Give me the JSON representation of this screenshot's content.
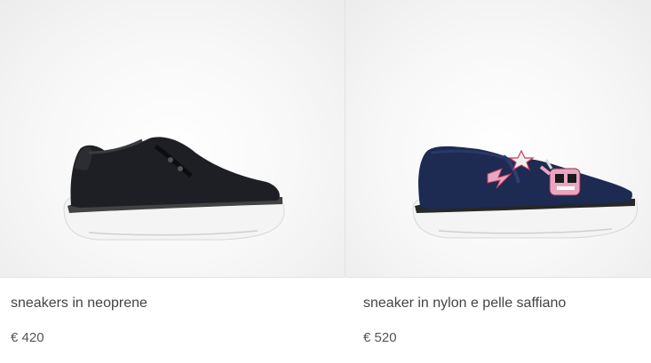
{
  "products": [
    {
      "name": "sneakers in neoprene",
      "price": "€ 420",
      "image_icon": "black-neoprene-sneaker-icon"
    },
    {
      "name": "sneaker in nylon e pelle saffiano",
      "price": "€ 520",
      "image_icon": "navy-nylon-slip-on-sneaker-icon"
    }
  ],
  "colors": {
    "text": "#444444",
    "price": "#555555",
    "divider": "#e1e1e1",
    "shoe_black": "#1e1f24",
    "shoe_navy": "#1d2a52",
    "patch_pink": "#e9a6c1"
  }
}
